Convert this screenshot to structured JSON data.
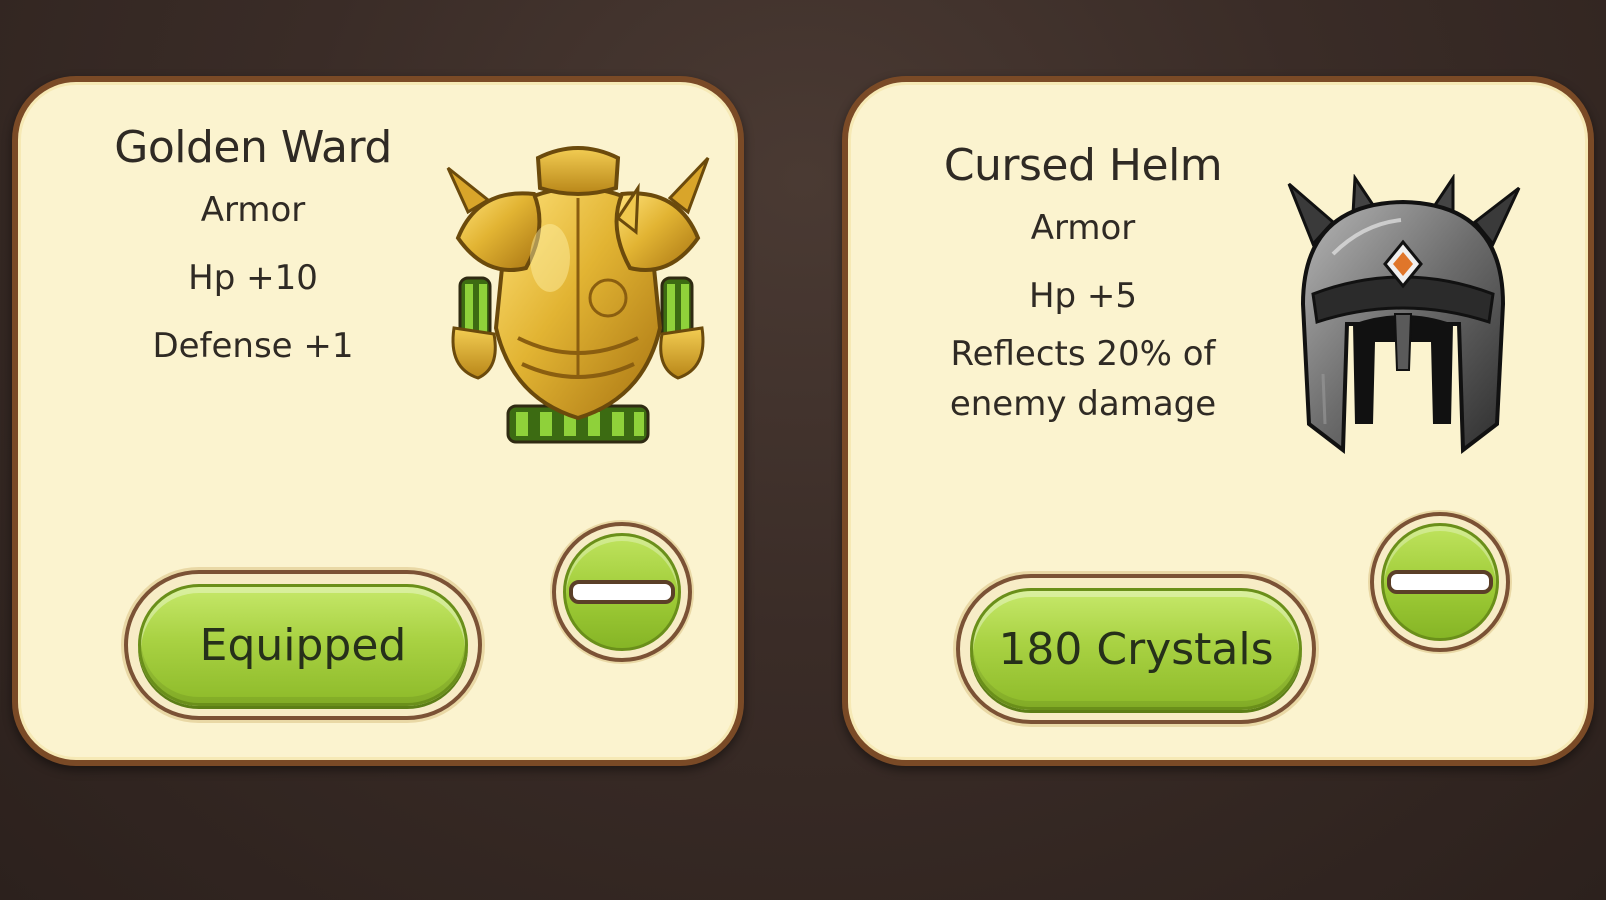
{
  "cards": [
    {
      "name": "Golden Ward",
      "type": "Armor",
      "stats": [
        "Hp +10",
        "Defense +1"
      ],
      "button_label": "Equipped",
      "item_icon": "golden-armor-icon"
    },
    {
      "name": "Cursed Helm",
      "type": "Armor",
      "stats": [
        "Hp +5",
        "Reflects 20% of",
        "enemy damage"
      ],
      "button_label": "180 Crystals",
      "item_icon": "cursed-helmet-icon"
    }
  ],
  "colors": {
    "card_bg": "#fbf3cf",
    "card_border": "#7a4a26",
    "button_green": "#a9d243",
    "background": "#3a2c27"
  }
}
